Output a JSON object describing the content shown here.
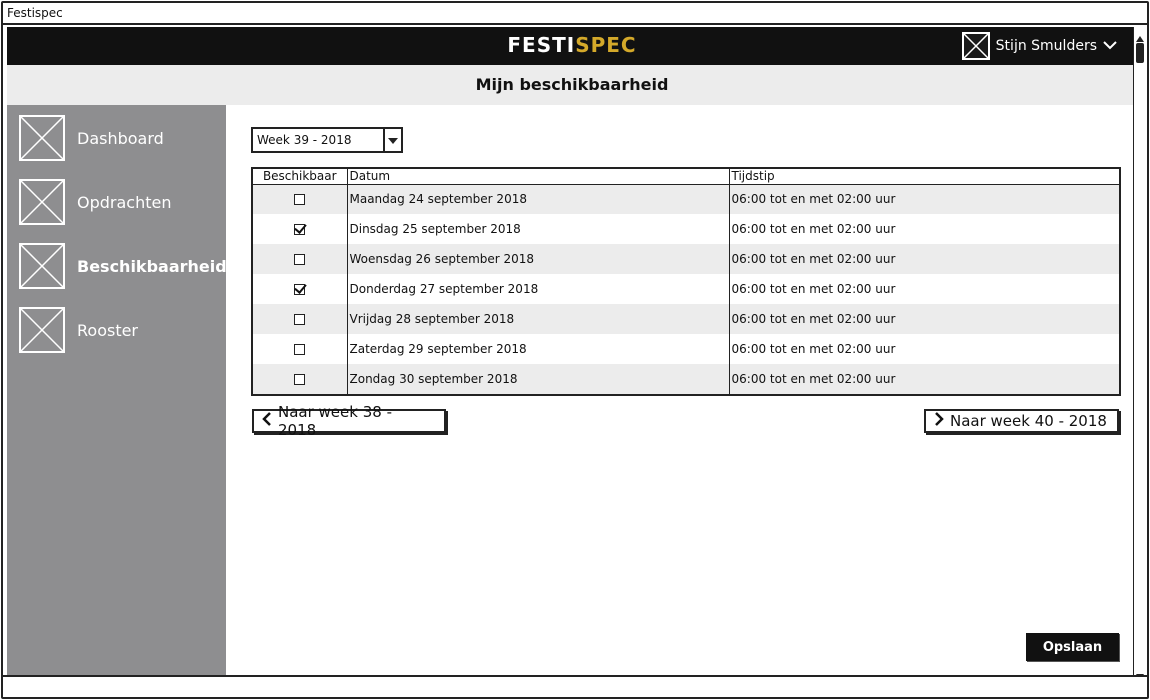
{
  "window": {
    "title": "Festispec"
  },
  "topbar": {
    "logo_part1": "FESTI",
    "logo_part2": "SPEC",
    "user_name": "Stijn Smulders",
    "user_avatar_icon": "image-placeholder-icon",
    "user_menu_icon": "chevron-down-icon"
  },
  "page": {
    "title": "Mijn beschikbaarheid"
  },
  "sidebar": {
    "items": [
      {
        "label": "Dashboard",
        "icon": "image-placeholder-icon",
        "active": false
      },
      {
        "label": "Opdrachten",
        "icon": "image-placeholder-icon",
        "active": false
      },
      {
        "label": "Beschikbaarheid",
        "icon": "image-placeholder-icon",
        "active": true
      },
      {
        "label": "Rooster",
        "icon": "image-placeholder-icon",
        "active": false
      }
    ]
  },
  "week_select": {
    "value": "Week 39 - 2018"
  },
  "table": {
    "columns": [
      "Beschikbaar",
      "Datum",
      "Tijdstip"
    ],
    "rows": [
      {
        "available": false,
        "date": "Maandag 24 september 2018",
        "time": "06:00 tot en met 02:00 uur"
      },
      {
        "available": true,
        "date": "Dinsdag 25 september 2018",
        "time": "06:00 tot en met 02:00 uur"
      },
      {
        "available": false,
        "date": "Woensdag 26 september 2018",
        "time": "06:00 tot en met 02:00 uur"
      },
      {
        "available": true,
        "date": "Donderdag 27 september 2018",
        "time": "06:00 tot en met 02:00 uur"
      },
      {
        "available": false,
        "date": "Vrijdag 28 september 2018",
        "time": "06:00 tot en met 02:00 uur"
      },
      {
        "available": false,
        "date": "Zaterdag 29 september 2018",
        "time": "06:00 tot en met 02:00 uur"
      },
      {
        "available": false,
        "date": "Zondag 30 september 2018",
        "time": "06:00 tot en met 02:00 uur"
      }
    ]
  },
  "pagination": {
    "prev_label": "Naar week 38 - 2018",
    "next_label": "Naar week 40 - 2018"
  },
  "actions": {
    "save_label": "Opslaan"
  },
  "colors": {
    "accent": "#d4a92a",
    "topbar": "#111111",
    "sidebar": "#8e8e90",
    "row_alt": "#ececec"
  }
}
